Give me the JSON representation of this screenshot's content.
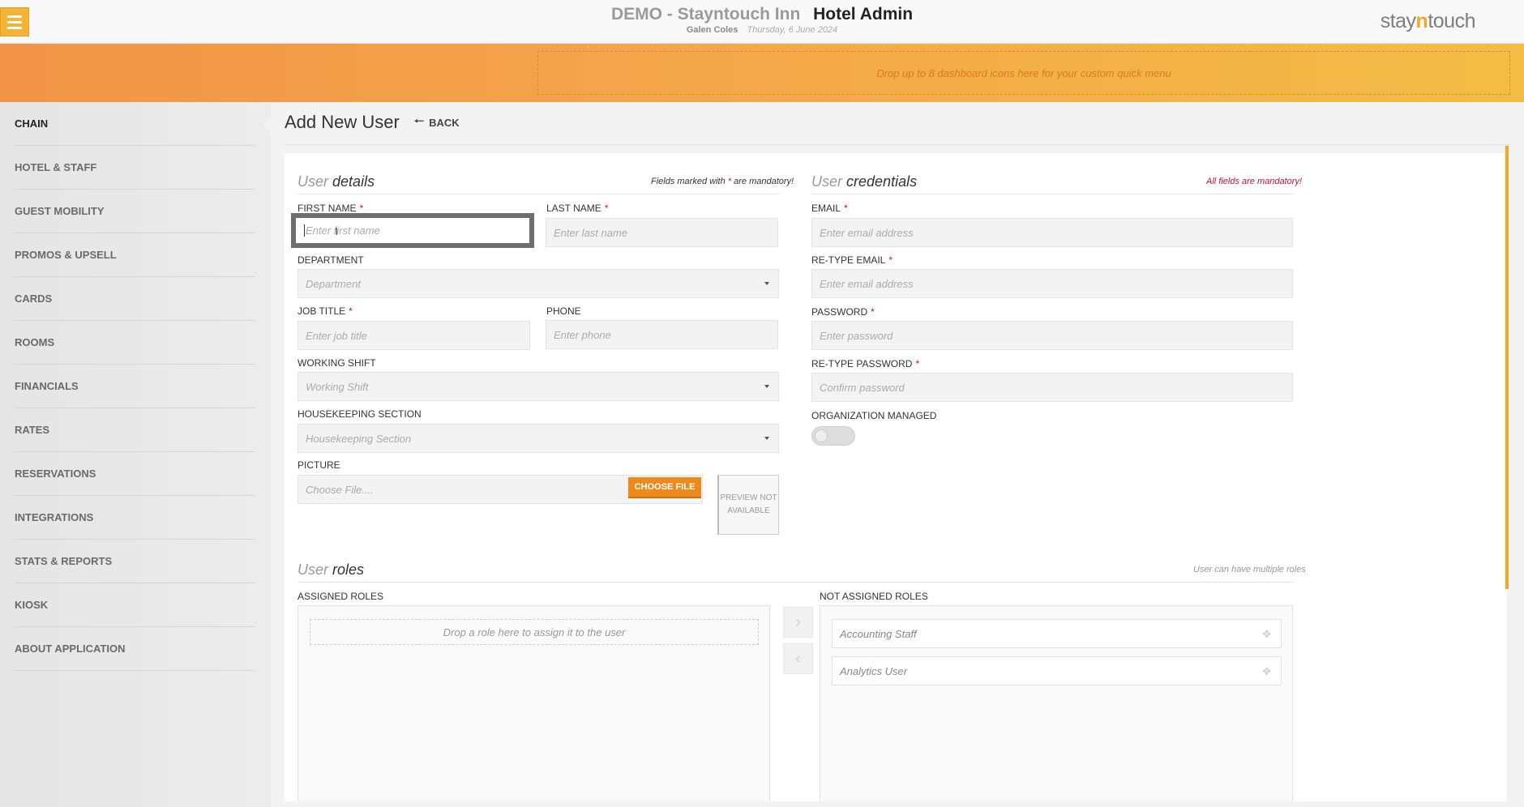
{
  "header": {
    "demo_label": "DEMO - Stayntouch Inn",
    "app_title": "Hotel Admin",
    "user_name": "Galen Coles",
    "date": "Thursday, 6 June 2024",
    "logo_prefix": "stay",
    "logo_n": "n",
    "logo_suffix": "touch"
  },
  "quick_menu": {
    "placeholder": "Drop up to 8 dashboard icons here for your custom quick menu"
  },
  "sidebar": {
    "items": [
      {
        "label": "CHAIN",
        "active": true
      },
      {
        "label": "HOTEL & STAFF"
      },
      {
        "label": "GUEST MOBILITY"
      },
      {
        "label": "PROMOS & UPSELL"
      },
      {
        "label": "CARDS"
      },
      {
        "label": "ROOMS"
      },
      {
        "label": "FINANCIALS"
      },
      {
        "label": "RATES"
      },
      {
        "label": "RESERVATIONS"
      },
      {
        "label": "INTEGRATIONS"
      },
      {
        "label": "STATS & REPORTS"
      },
      {
        "label": "KIOSK"
      },
      {
        "label": "ABOUT APPLICATION"
      }
    ]
  },
  "page": {
    "title": "Add New User",
    "back_label": "BACK",
    "back_arrow": "🠐"
  },
  "user_details": {
    "title_light": "User",
    "title_main": "details",
    "note_before": "Fields marked with",
    "note_star": "*",
    "note_after": "are mandatory!",
    "first_name": {
      "label": "FIRST NAME",
      "required": "*",
      "placeholder": "Enter first name",
      "value": ""
    },
    "last_name": {
      "label": "LAST NAME",
      "required": "*",
      "placeholder": "Enter last name"
    },
    "department": {
      "label": "DEPARTMENT",
      "placeholder": "Department"
    },
    "job_title": {
      "label": "JOB TITLE",
      "required": "*",
      "placeholder": "Enter job title"
    },
    "phone": {
      "label": "PHONE",
      "placeholder": "Enter phone"
    },
    "working_shift": {
      "label": "WORKING SHIFT",
      "placeholder": "Working Shift"
    },
    "housekeeping": {
      "label": "HOUSEKEEPING SECTION",
      "placeholder": "Housekeeping Section"
    },
    "picture": {
      "label": "PICTURE",
      "placeholder": "Choose File....",
      "button": "CHOOSE FILE",
      "preview_line1": "PREVIEW NOT",
      "preview_line2": "AVAILABLE"
    }
  },
  "credentials": {
    "title_light": "User",
    "title_main": "credentials",
    "note": "All fields are mandatory!",
    "email": {
      "label": "EMAIL",
      "required": "*",
      "placeholder": "Enter email address"
    },
    "retype_email": {
      "label": "RE-TYPE EMAIL",
      "required": "*",
      "placeholder": "Enter email address"
    },
    "password": {
      "label": "PASSWORD",
      "required": "*",
      "placeholder": "Enter password"
    },
    "retype_password": {
      "label": "RE-TYPE PASSWORD",
      "required": "*",
      "placeholder": "Confirm password"
    },
    "org_managed": {
      "label": "ORGANIZATION MANAGED",
      "enabled": false
    }
  },
  "roles": {
    "title_light": "User",
    "title_main": "roles",
    "note": "User can have multiple roles",
    "assigned_label": "ASSIGNED ROLES",
    "assigned_drop": "Drop a role here to assign it to the user",
    "not_assigned_label": "NOT ASSIGNED ROLES",
    "not_assigned": [
      {
        "name": "Accounting Staff"
      },
      {
        "name": "Analytics User"
      }
    ]
  },
  "colors": {
    "accent": "#f5a623",
    "button": "#ee8a1c",
    "required": "#c8102e"
  }
}
